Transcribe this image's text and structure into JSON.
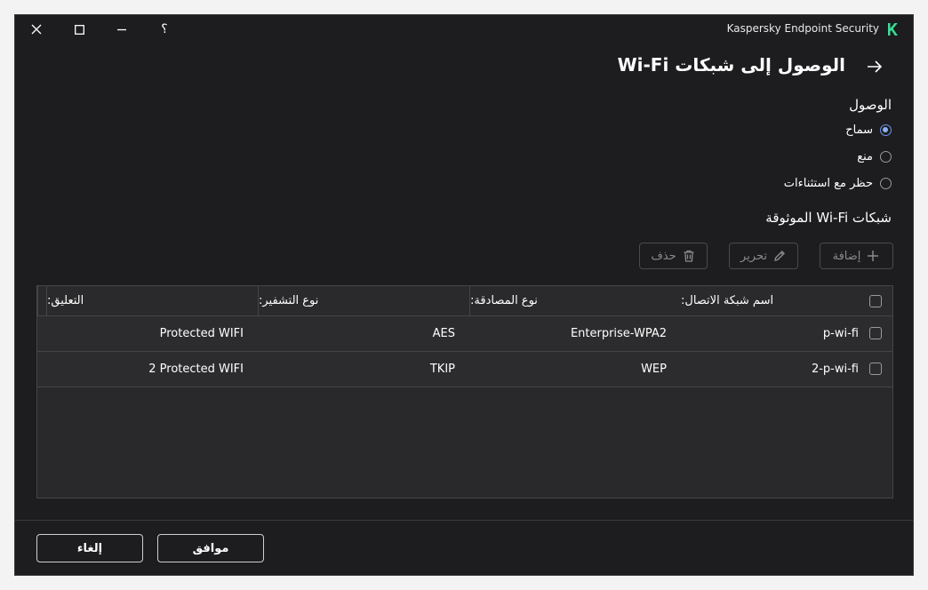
{
  "window": {
    "app_title": "Kaspersky Endpoint Security",
    "help_label": "؟",
    "accent_color": "#3ddc97"
  },
  "page": {
    "title": "الوصول إلى شبكات Wi-Fi"
  },
  "access": {
    "section_title": "الوصول",
    "options": [
      {
        "label": "سماح",
        "checked": true
      },
      {
        "label": "منع",
        "checked": false
      },
      {
        "label": "حظر مع استثناءات",
        "checked": false
      }
    ]
  },
  "trusted": {
    "section_title": "شبكات Wi-Fi الموثوقة"
  },
  "toolbar": {
    "add_label": "إضافة",
    "edit_label": "تحرير",
    "delete_label": "حذف"
  },
  "table": {
    "columns": [
      "اسم شبكة الاتصال:",
      "نوع المصادقة:",
      "نوع التشفير:",
      "التعليق:"
    ],
    "rows": [
      {
        "name": "p-wi-fi",
        "auth": "Enterprise-WPA2",
        "encryption": "AES",
        "comment": "Protected WIFI"
      },
      {
        "name": "2-p-wi-fi",
        "auth": "WEP",
        "encryption": "TKIP",
        "comment": "2 Protected WIFI"
      }
    ]
  },
  "footer": {
    "ok_label": "موافق",
    "cancel_label": "إلغاء"
  }
}
